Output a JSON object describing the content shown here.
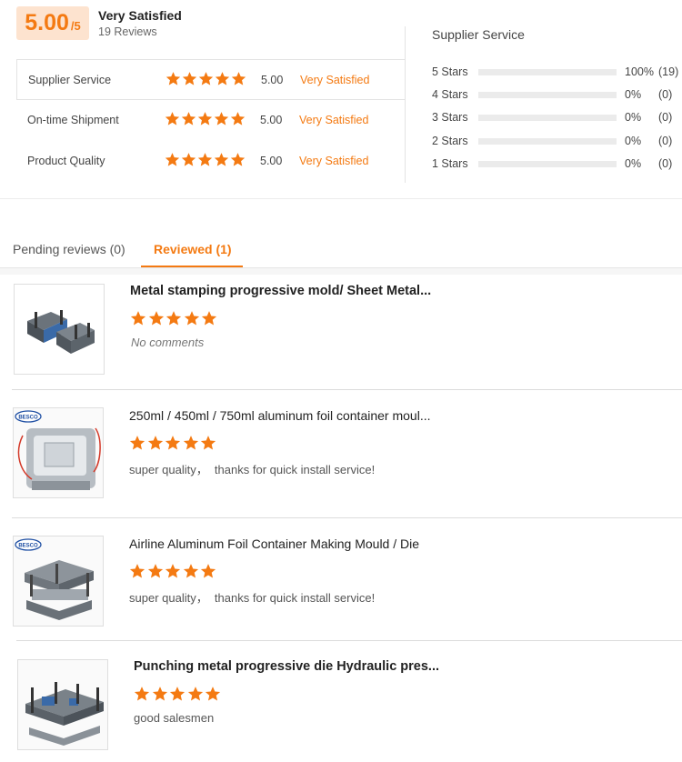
{
  "summary": {
    "score": "5.00",
    "score_max": "/5",
    "label": "Very Satisfied",
    "reviews_count": "19 Reviews"
  },
  "ratings": [
    {
      "label": "Supplier Service",
      "value": "5.00",
      "satisfaction": "Very Satisfied",
      "stars": 5
    },
    {
      "label": "On-time Shipment",
      "value": "5.00",
      "satisfaction": "Very Satisfied",
      "stars": 5
    },
    {
      "label": "Product Quality",
      "value": "5.00",
      "satisfaction": "Very Satisfied",
      "stars": 5
    }
  ],
  "distribution": {
    "title": "Supplier Service",
    "rows": [
      {
        "label": "5 Stars",
        "percent": "100%",
        "count": "(19)",
        "fraction": 1.0
      },
      {
        "label": "4 Stars",
        "percent": "0%",
        "count": "(0)",
        "fraction": 0
      },
      {
        "label": "3 Stars",
        "percent": "0%",
        "count": "(0)",
        "fraction": 0
      },
      {
        "label": "2 Stars",
        "percent": "0%",
        "count": "(0)",
        "fraction": 0
      },
      {
        "label": "1 Stars",
        "percent": "0%",
        "count": "(0)",
        "fraction": 0
      }
    ]
  },
  "tabs": {
    "pending": "Pending reviews (0)",
    "reviewed": "Reviewed (1)"
  },
  "reviews": [
    {
      "title": "Metal stamping progressive mold/ Sheet Metal...",
      "stars": 5,
      "comment": "No comments",
      "image_icon": "mold-product-image"
    },
    {
      "title": "250ml / 450ml / 750ml aluminum foil container moul...",
      "stars": 5,
      "comment": "super quality，  thanks for quick install service!",
      "image_icon": "foil-container-mould-image",
      "brand": "BESCO"
    },
    {
      "title": "Airline Aluminum Foil Container Making Mould / Die",
      "stars": 5,
      "comment": "super quality，  thanks for quick install service!",
      "image_icon": "airline-mould-image",
      "brand": "BESCO"
    },
    {
      "title": "Punching metal progressive die Hydraulic pres...",
      "stars": 5,
      "comment": "good salesmen",
      "image_icon": "punching-die-image"
    }
  ],
  "colors": {
    "accent": "#f47a12",
    "badge_bg": "#fde3cf"
  }
}
